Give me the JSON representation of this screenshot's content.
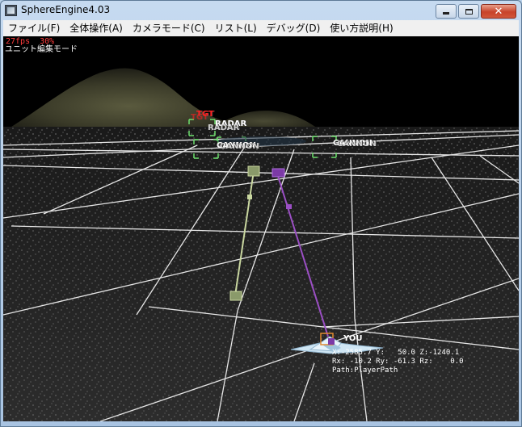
{
  "window": {
    "title": "SphereEngine4.03"
  },
  "menu": [
    "ファイル(F)",
    "全体操作(A)",
    "カメラモード(C)",
    "リスト(L)",
    "デバッグ(D)",
    "使い方説明(H)"
  ],
  "hud": {
    "fps": "27fps  30%",
    "mode": "ユニット編集モード"
  },
  "labels": {
    "tgt": "TGT",
    "tgt_ghost": "TGT",
    "radar": "RADAR",
    "radar_ghost": "RADAR",
    "cannon_left": "CANNON",
    "cannon_left_ghost": "CANNON",
    "cannon_right": "CANNON",
    "cannon_right_ghost": "CANNON",
    "you": "YOU"
  },
  "player_info": {
    "line1": "X:-2585.7 Y:   50.0 Z:-1240.1",
    "line2": "Rx: -10.2 Ry: -61.3 Rz:    0.0",
    "line3": "Path:PlayerPath"
  },
  "colors": {
    "grid": "#e6e6e6",
    "path_green": "#c9d7a0",
    "path_purple": "#9b4fc4",
    "marker_green": "#6ee06e",
    "hud_red": "#ff3b3b"
  }
}
